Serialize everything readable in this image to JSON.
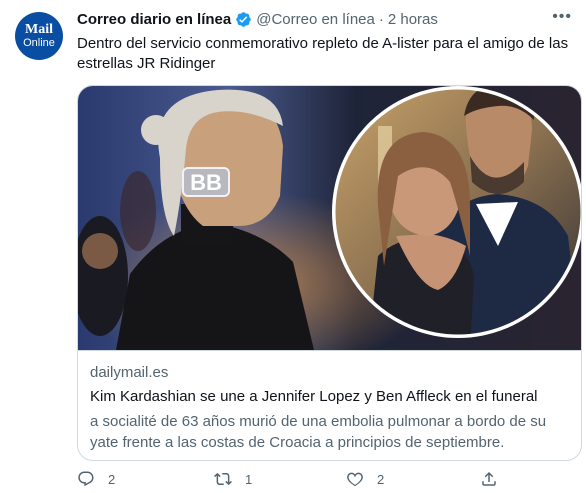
{
  "author": {
    "avatar_line1": "Mail",
    "avatar_line2": "Online",
    "name": "Correo diario en línea",
    "handle": "@Correo en línea",
    "separator": "·",
    "time": "2 horas"
  },
  "tweet_text": "Dentro del servicio conmemorativo repleto de A-lister para el amigo de las estrellas JR Ridinger",
  "card": {
    "domain": "dailymail.es",
    "title": "Kim Kardashian se une a Jennifer Lopez y Ben Affleck en el funeral",
    "description": "a socialité de 63 años murió de una embolia pulmonar a bordo de su yate frente a las costas de Croacia a principios de septiembre.",
    "earring_text": "BB"
  },
  "actions": {
    "reply_count": "2",
    "retweet_count": "1",
    "like_count": "2"
  },
  "icons": {
    "verified": "verified-badge-icon",
    "more": "more-icon",
    "reply": "reply-icon",
    "retweet": "retweet-icon",
    "like": "heart-icon",
    "share": "share-icon"
  },
  "colors": {
    "verified": "#1d9bf0",
    "secondary_text": "#536471",
    "border": "#cfd9de",
    "avatar_bg": "#0a4ea3"
  }
}
